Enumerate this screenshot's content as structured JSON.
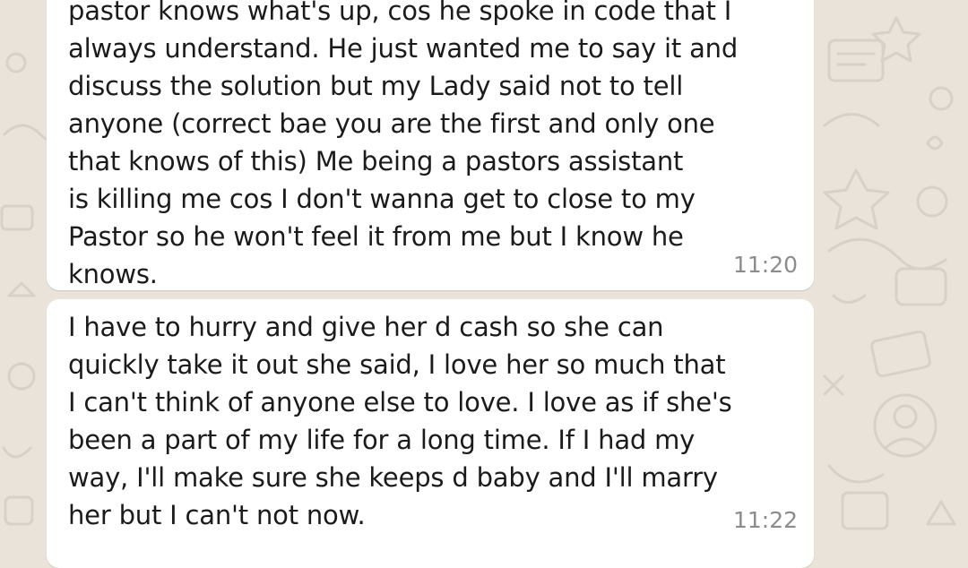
{
  "messages": [
    {
      "text": "pastor knows what's up, cos he spoke in code that I\nalways understand. He just wanted me to say it and\ndiscuss the solution but my Lady said not to tell\nanyone (correct bae you are the first and only one\nthat knows of this) Me being a pastors assistant\nis killing me cos I don't wanna get to close to my\nPastor so he won't feel it from me but I know he\nknows.",
      "time": "11:20"
    },
    {
      "text": "I have to hurry and give her d cash so she can\nquickly take it out she said, I love her so much that\nI can't think of anyone else to love. I love as if she's\nbeen a part of my life for a long time. If I had my\nway, I'll make sure she keeps d baby and I'll marry\nher but I can't not now.",
      "time": "11:22"
    }
  ],
  "colors": {
    "wallpaper": "#e9e3da",
    "bubble": "#ffffff",
    "text": "#1b1b1b",
    "timestamp": "#8c8c8c"
  }
}
